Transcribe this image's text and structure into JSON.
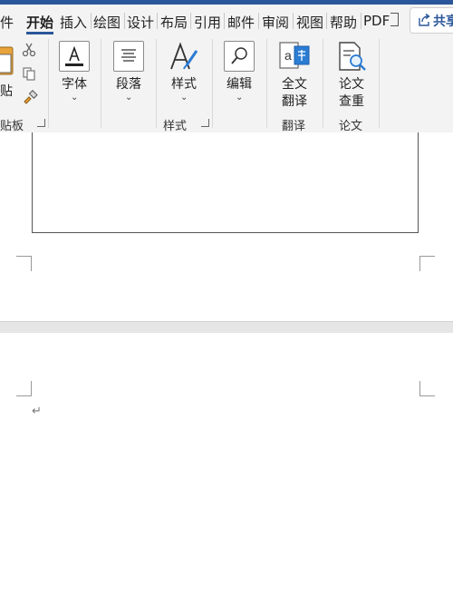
{
  "tabs": {
    "file": "件",
    "home": "开始",
    "insert": "插入",
    "draw": "绘图",
    "design": "设计",
    "layout": "布局",
    "references": "引用",
    "mailings": "邮件",
    "review": "审阅",
    "view": "视图",
    "help": "帮助",
    "pdf": "PDF",
    "share": "共享"
  },
  "ribbon": {
    "clipboard": {
      "paste_label": "贴",
      "group_label": "贴板"
    },
    "font": {
      "label": "字体"
    },
    "paragraph": {
      "label": "段落"
    },
    "styles": {
      "label": "样式",
      "group_label": "样式"
    },
    "editing": {
      "label": "编辑"
    },
    "translate": {
      "label_line1": "全文",
      "label_line2": "翻译",
      "group_label": "翻译"
    },
    "paper": {
      "label_line1": "论文",
      "label_line2": "查重",
      "group_label": "论文"
    }
  },
  "document": {
    "paragraph_mark": "↵"
  },
  "colors": {
    "accent": "#2b579a",
    "ribbon_bg": "#f3f3f3",
    "paste_icon": "#e8a33a"
  }
}
